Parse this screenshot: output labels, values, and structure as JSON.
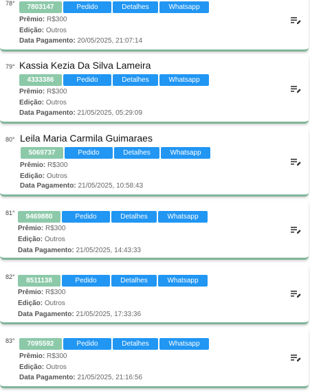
{
  "labels": {
    "pedido": "Pedido",
    "detalhes": "Detalhes",
    "whatsapp": "Whatsapp",
    "premio": "Prêmio:",
    "edicao": "Edição:",
    "data_pagamento": "Data Pagamento:"
  },
  "cards": [
    {
      "rank": "78°",
      "name": "",
      "code": "7803147",
      "premio": "R$300",
      "edicao": "Outros",
      "data": "20/05/2025, 21:07:14"
    },
    {
      "rank": "79°",
      "name": "Kassia Kezia Da Silva Lameira",
      "code": "4333386",
      "premio": "R$300",
      "edicao": "Outros",
      "data": "21/05/2025, 05:29:09"
    },
    {
      "rank": "80°",
      "name": "Leila Maria Carmila Guimaraes",
      "code": "5069737",
      "premio": "R$300",
      "edicao": "Outros",
      "data": "21/05/2025, 10:58:43"
    },
    {
      "rank": "81°",
      "name": "",
      "code": "9469880",
      "premio": "R$300",
      "edicao": "Outros",
      "data": "21/05/2025, 14:43:33"
    },
    {
      "rank": "82°",
      "name": "",
      "code": "8511138",
      "premio": "R$300",
      "edicao": "Outros",
      "data": "21/05/2025, 17:33:36"
    },
    {
      "rank": "83°",
      "name": "",
      "code": "7095592",
      "premio": "R$300",
      "edicao": "Outros",
      "data": "21/05/2025, 21:16:56"
    }
  ],
  "colors": {
    "code_badge": "#8cc9a9",
    "button": "#2196f3",
    "card_border": "#7fb59a"
  },
  "icons": {
    "edit": "edit-note-icon"
  }
}
